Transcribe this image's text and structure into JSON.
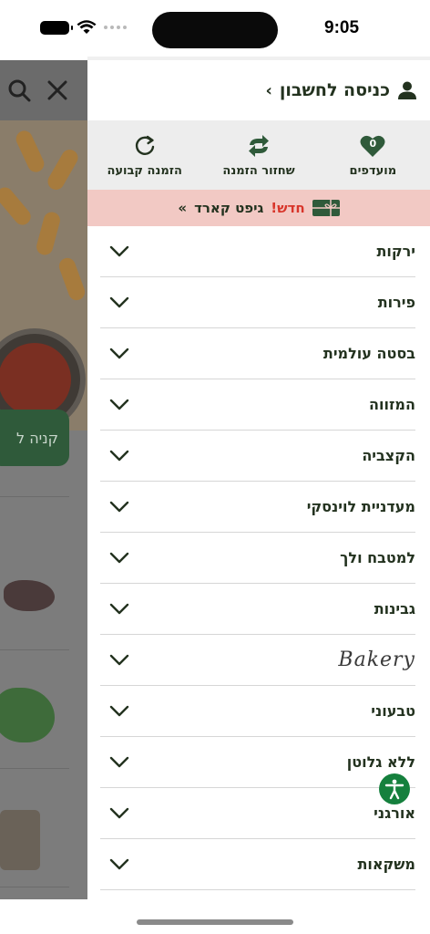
{
  "status_bar": {
    "time": "9:05"
  },
  "drawer": {
    "account": {
      "label": "כניסה לחשבון",
      "chevron": "‹"
    },
    "actions": [
      {
        "label": "מועדפים",
        "badge": "0",
        "icon": "heart-icon"
      },
      {
        "label": "שחזור הזמנה",
        "icon": "repeat-icon"
      },
      {
        "label": "הזמנה קבועה",
        "icon": "refresh-icon"
      }
    ],
    "promo": {
      "new": "חדש!",
      "text": "גיפט קארד",
      "arrow": "»"
    },
    "categories": [
      "ירקות",
      "פירות",
      "בסטה עולמית",
      "המזווה",
      "הקצביה",
      "מעדניית לוינסקי",
      "למטבח ולך",
      "גבינות",
      "Bakery",
      "טבעוני",
      "ללא גלוטן",
      "אורגני",
      "משקאות"
    ]
  },
  "background_page": {
    "button_text": "קניה ל"
  },
  "colors": {
    "accent": "#2f5a3a",
    "promo_bg": "#f2c9c4",
    "promo_new": "#d8352a",
    "a11y": "#15803d"
  }
}
